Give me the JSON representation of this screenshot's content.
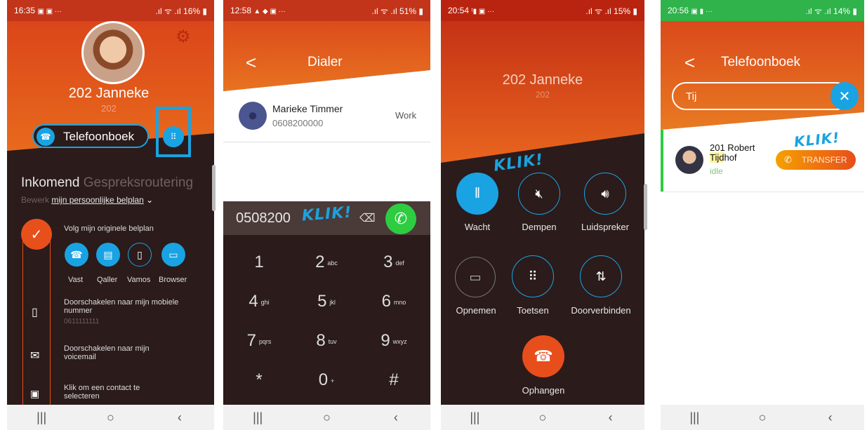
{
  "p1": {
    "status": {
      "time": "16:35",
      "icons": "▩ ▩ ...",
      "right": "16%"
    },
    "name": "202  Janneke",
    "ext": "202",
    "phonebook_label": "Telefoonboek",
    "routing_title_a": "Inkomend",
    "routing_title_b": "Gespreksroutering",
    "edit_prefix": "Bewerk",
    "edit_link": "mijn persoonlijke belplan",
    "follow_label": "Volg mijn originele belplan",
    "devices": [
      "Vast",
      "Qaller",
      "Vamos",
      "Browser"
    ],
    "forward_mobile": "Doorschakelen naar mijn mobiele nummer",
    "mobile_number": "0611111111",
    "forward_voicemail": "Doorschakelen naar mijn voicemail",
    "contact_select": "Klik om een contact te selecteren"
  },
  "p2": {
    "status": {
      "time": "12:58",
      "right": "51%"
    },
    "title": "Dialer",
    "back": "<",
    "contact_name": "Marieke Timmer",
    "contact_number": "0608200000",
    "contact_type": "Work",
    "dial_input": "0508200",
    "klik": "KLIK!",
    "keys": [
      {
        "d": "1",
        "l": ""
      },
      {
        "d": "2",
        "l": "abc"
      },
      {
        "d": "3",
        "l": "def"
      },
      {
        "d": "4",
        "l": "ghi"
      },
      {
        "d": "5",
        "l": "jkl"
      },
      {
        "d": "6",
        "l": "mno"
      },
      {
        "d": "7",
        "l": "pqrs"
      },
      {
        "d": "8",
        "l": "tuv"
      },
      {
        "d": "9",
        "l": "wxyz"
      },
      {
        "d": "*",
        "l": ""
      },
      {
        "d": "0",
        "l": "+"
      },
      {
        "d": "#",
        "l": ""
      }
    ]
  },
  "p3": {
    "status": {
      "time": "20:54",
      "right": "15%"
    },
    "name": "202  Janneke",
    "ext": "202",
    "klik": "KLIK!",
    "hold": "Wacht",
    "mute": "Dempen",
    "speaker": "Luidspreker",
    "record": "Opnemen",
    "keypad": "Toetsen",
    "transfer": "Doorverbinden",
    "hangup": "Ophangen"
  },
  "p4": {
    "status": {
      "time": "20:56",
      "right": "14%"
    },
    "title": "Telefoonboek",
    "back": "<",
    "search_value": "Tij",
    "contact_name_a": "201 Robert",
    "contact_name_b": "Tijdhof",
    "contact_state": "idle",
    "transfer_label": "TRANSFER",
    "klik": "KLIK!"
  },
  "colors": {
    "accent": "#e84e1b",
    "blue": "#19a3e3",
    "dark": "#2b1b1b",
    "green": "#2ecc40"
  }
}
